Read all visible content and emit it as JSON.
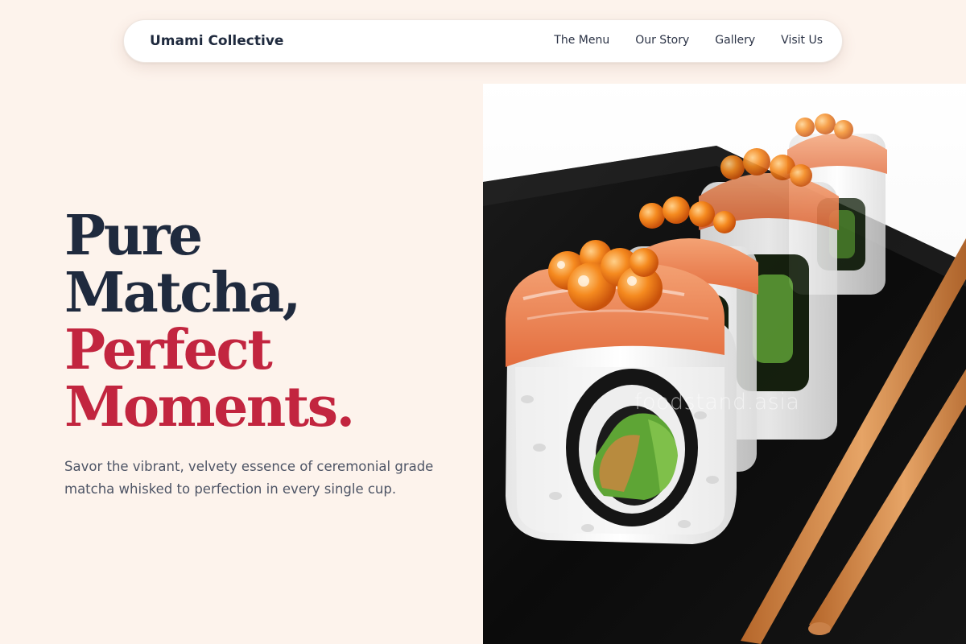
{
  "nav": {
    "brand": "Umami Collective",
    "links": [
      "The Menu",
      "Our Story",
      "Gallery",
      "Visit Us"
    ]
  },
  "hero": {
    "headline_lines": [
      "Pure",
      "Matcha,",
      "Perfect",
      "Moments."
    ],
    "description": "Savor the vibrant, velvety essence of ceremonial grade matcha whisked to perfection in every single cup.",
    "image_watermark": "foodstand.asia"
  },
  "colors": {
    "background": "#fdf3ec",
    "headline_dark": "#1f2a3e",
    "headline_accent": "#c2253f",
    "body_text": "#4e5566"
  }
}
